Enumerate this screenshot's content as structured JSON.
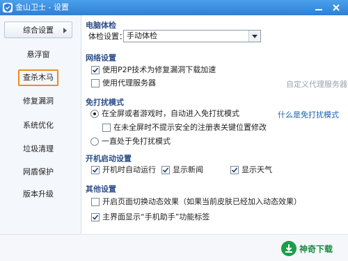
{
  "window": {
    "title": "金山卫士 - 设置"
  },
  "sidebar": {
    "items": [
      {
        "label": "综合设置"
      },
      {
        "label": "悬浮窗"
      },
      {
        "label": "查杀木马"
      },
      {
        "label": "修复漏洞"
      },
      {
        "label": "系统优化"
      },
      {
        "label": "垃圾清理"
      },
      {
        "label": "网盾保护"
      },
      {
        "label": "版本升级"
      }
    ]
  },
  "pc_check": {
    "title": "电脑体检",
    "label": "体检设置：",
    "select_value": "手动体检"
  },
  "network": {
    "title": "网络设置",
    "p2p_label": "使用P2P技术为修复漏洞下载加速",
    "p2p_checked": true,
    "proxy_label": "使用代理服务器",
    "proxy_checked": false,
    "custom_proxy_link": "自定义代理服务器"
  },
  "dnd": {
    "title": "免打扰模式",
    "option1_label": "在全屏或者游戏时，自动进入免打扰模式",
    "what_link": "什么是免打扰模式",
    "sub_label": "在未全屏时不提示安全的注册表关键位置修改",
    "option2_label": "一直处于免打扰模式"
  },
  "startup": {
    "title": "开机启动设置",
    "auto_run_label": "开机时自动运行",
    "news_label": "显示新闻",
    "weather_label": "显示天气"
  },
  "other": {
    "title": "其他设置",
    "switch_effect_label": "开启页面切换动态效果（如果当前皮肤已经加入动态效果）",
    "phone_helper_label": "主界面显示“手机助手”功能标签"
  },
  "watermark": {
    "text": "神奇下载"
  }
}
